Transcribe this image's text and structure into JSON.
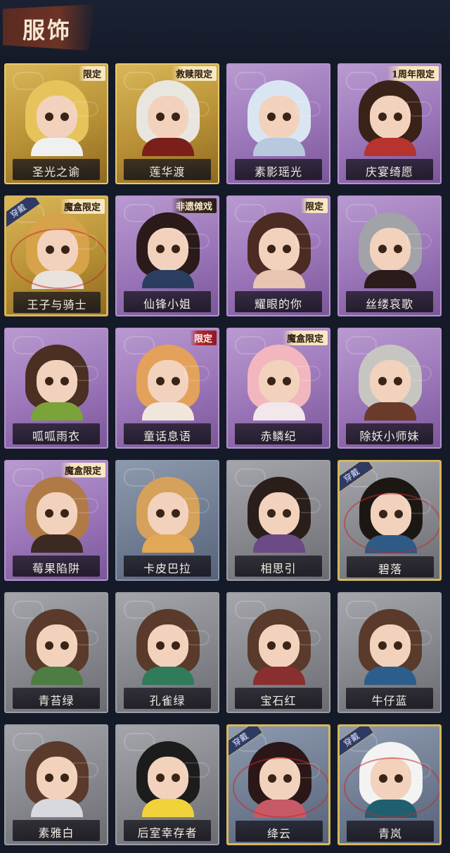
{
  "header": {
    "title": "服饰"
  },
  "grid": {
    "items": [
      {
        "name": "圣光之谕",
        "tag": "限定",
        "rarity": "gold",
        "equipped": false,
        "colors": {
          "hair": "#e7c35c",
          "body": "#f0f0f0"
        }
      },
      {
        "name": "莲华渡",
        "tag": "救赎限定",
        "rarity": "gold",
        "equipped": false,
        "colors": {
          "hair": "#e9e6e0",
          "body": "#7a1f1a"
        }
      },
      {
        "name": "素影瑶光",
        "tag": "",
        "rarity": "purple",
        "equipped": false,
        "colors": {
          "hair": "#d9e6f2",
          "body": "#b8c9df"
        }
      },
      {
        "name": "庆宴绮愿",
        "tag": "1周年限定",
        "rarity": "purple",
        "equipped": false,
        "colors": {
          "hair": "#3a2218",
          "body": "#b7332e"
        }
      },
      {
        "name": "王子与骑士",
        "tag": "魔盒限定",
        "rarity": "gold",
        "equipped": true,
        "colors": {
          "hair": "#d6a24a",
          "body": "#e9e2dd"
        }
      },
      {
        "name": "仙锋小姐",
        "tag": "非遗傩戏",
        "rarity": "purple",
        "equipped": false,
        "colors": {
          "hair": "#2a1a1a",
          "body": "#2b3e62"
        }
      },
      {
        "name": "耀眼的你",
        "tag": "限定",
        "rarity": "purple",
        "equipped": false,
        "colors": {
          "hair": "#4b2b22",
          "body": "#e7c5b0"
        }
      },
      {
        "name": "丝缕哀歌",
        "tag": "",
        "rarity": "purple",
        "equipped": false,
        "colors": {
          "hair": "#a2a3a8",
          "body": "#2b1b1b"
        }
      },
      {
        "name": "呱呱雨衣",
        "tag": "",
        "rarity": "purple",
        "equipped": false,
        "colors": {
          "hair": "#4a2f22",
          "body": "#7aa33a"
        }
      },
      {
        "name": "童话息语",
        "tag": "限定",
        "rarity": "purple",
        "equipped": false,
        "colors": {
          "hair": "#e3a15b",
          "body": "#f1e6dc"
        }
      },
      {
        "name": "赤鳞纪",
        "tag": "魔盒限定",
        "rarity": "purple",
        "equipped": false,
        "colors": {
          "hair": "#f2b6be",
          "body": "#f2e7ea"
        }
      },
      {
        "name": "除妖小师妹",
        "tag": "",
        "rarity": "purple",
        "equipped": false,
        "colors": {
          "hair": "#c7c5c1",
          "body": "#6a3a2a"
        }
      },
      {
        "name": "莓果陷阱",
        "tag": "魔盒限定",
        "rarity": "purple",
        "equipped": false,
        "colors": {
          "hair": "#b07a46",
          "body": "#3c2a22"
        }
      },
      {
        "name": "卡皮巴拉",
        "tag": "",
        "rarity": "blue",
        "equipped": false,
        "colors": {
          "hair": "#d5a15b",
          "body": "#e0a857"
        }
      },
      {
        "name": "相思引",
        "tag": "",
        "rarity": "gray",
        "equipped": false,
        "colors": {
          "hair": "#2a1e1a",
          "body": "#6b4a85"
        }
      },
      {
        "name": "碧落",
        "tag": "",
        "rarity": "gray",
        "equipped": true,
        "colors": {
          "hair": "#1d1714",
          "body": "#2e5a86"
        }
      },
      {
        "name": "青苔绿",
        "tag": "",
        "rarity": "gray",
        "equipped": false,
        "colors": {
          "hair": "#5a3a2a",
          "body": "#4e7d44"
        }
      },
      {
        "name": "孔雀绿",
        "tag": "",
        "rarity": "gray",
        "equipped": false,
        "colors": {
          "hair": "#5a3a2a",
          "body": "#2f7b5a"
        }
      },
      {
        "name": "宝石红",
        "tag": "",
        "rarity": "gray",
        "equipped": false,
        "colors": {
          "hair": "#5a3a2a",
          "body": "#8a2f2f"
        }
      },
      {
        "name": "牛仔蓝",
        "tag": "",
        "rarity": "gray",
        "equipped": false,
        "colors": {
          "hair": "#5a3a2a",
          "body": "#2c5e8c"
        }
      },
      {
        "name": "素雅白",
        "tag": "",
        "rarity": "gray",
        "equipped": false,
        "colors": {
          "hair": "#5a3a2a",
          "body": "#d7d9de"
        }
      },
      {
        "name": "后室幸存者",
        "tag": "",
        "rarity": "gray",
        "equipped": false,
        "colors": {
          "hair": "#1c1c1c",
          "body": "#f1d23a"
        }
      },
      {
        "name": "绛云",
        "tag": "",
        "rarity": "blue",
        "equipped": true,
        "colors": {
          "hair": "#2b1718",
          "body": "#c85a67"
        }
      },
      {
        "name": "青岚",
        "tag": "",
        "rarity": "blue",
        "equipped": true,
        "colors": {
          "hair": "#f3f3f3",
          "body": "#1f5f70"
        }
      }
    ],
    "equip_label": "穿戴"
  }
}
